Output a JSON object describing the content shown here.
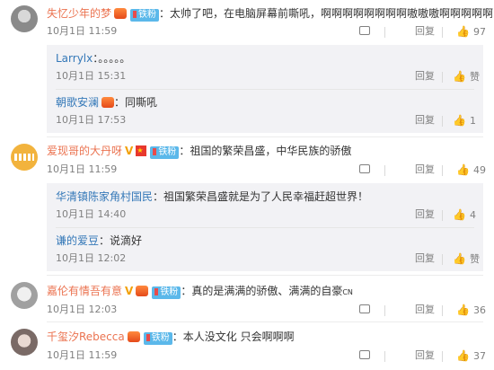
{
  "comments": [
    {
      "author": "失忆少年的梦",
      "text": "太帅了吧，在电脑屏幕前嘶吼，啊啊啊啊啊啊啊啊嗷嗷嗷啊啊啊啊啊",
      "fan_badge": "铁粉",
      "time": "10月1日 11:59",
      "reply_label": "回复",
      "like_count": "97",
      "replies": [
        {
          "author": "Larrylx",
          "text": "。。。。。",
          "time": "10月1日 15:31",
          "reply_label": "回复",
          "like_label": "赞"
        },
        {
          "author": "朝歌安澜",
          "text": "同嘶吼",
          "time": "10月1日 17:53",
          "reply_label": "回复",
          "like_count": "1"
        }
      ]
    },
    {
      "author": "爱现哥的大丹呀",
      "text": "祖国的繁荣昌盛，中华民族的骄傲",
      "fan_badge": "铁粉",
      "time": "10月1日 11:59",
      "reply_label": "回复",
      "like_count": "49",
      "replies": [
        {
          "author": "华清镇陈家角村国民",
          "text": "祖国繁荣昌盛就是为了人民幸福赶超世界！",
          "time": "10月1日 14:40",
          "reply_label": "回复",
          "like_count": "4"
        },
        {
          "author": "谦的爱豆",
          "text": "说滴好",
          "time": "10月1日 12:02",
          "reply_label": "回复",
          "like_label": "赞"
        }
      ]
    },
    {
      "author": "嘉伦有情吾有意",
      "text": "真的是满满的骄傲、满满的自豪",
      "text_suffix": "CN",
      "fan_badge": "铁粉",
      "time": "10月1日 12:03",
      "reply_label": "回复",
      "like_count": "36"
    },
    {
      "author": "千玺汐Rebecca",
      "text": "本人没文化 只会啊啊啊",
      "fan_badge": "铁粉",
      "time": "10月1日 11:59",
      "reply_label": "回复",
      "like_count": "37"
    }
  ],
  "icons": {
    "forward": "forward-icon",
    "like": "thumbs-up-icon"
  },
  "colors": {
    "author_link": "#eb7350",
    "reply_author_link": "#3478b8",
    "fan_badge": "#5bb8ea",
    "meta_text": "#808080",
    "reply_background": "#f2f2f5"
  }
}
